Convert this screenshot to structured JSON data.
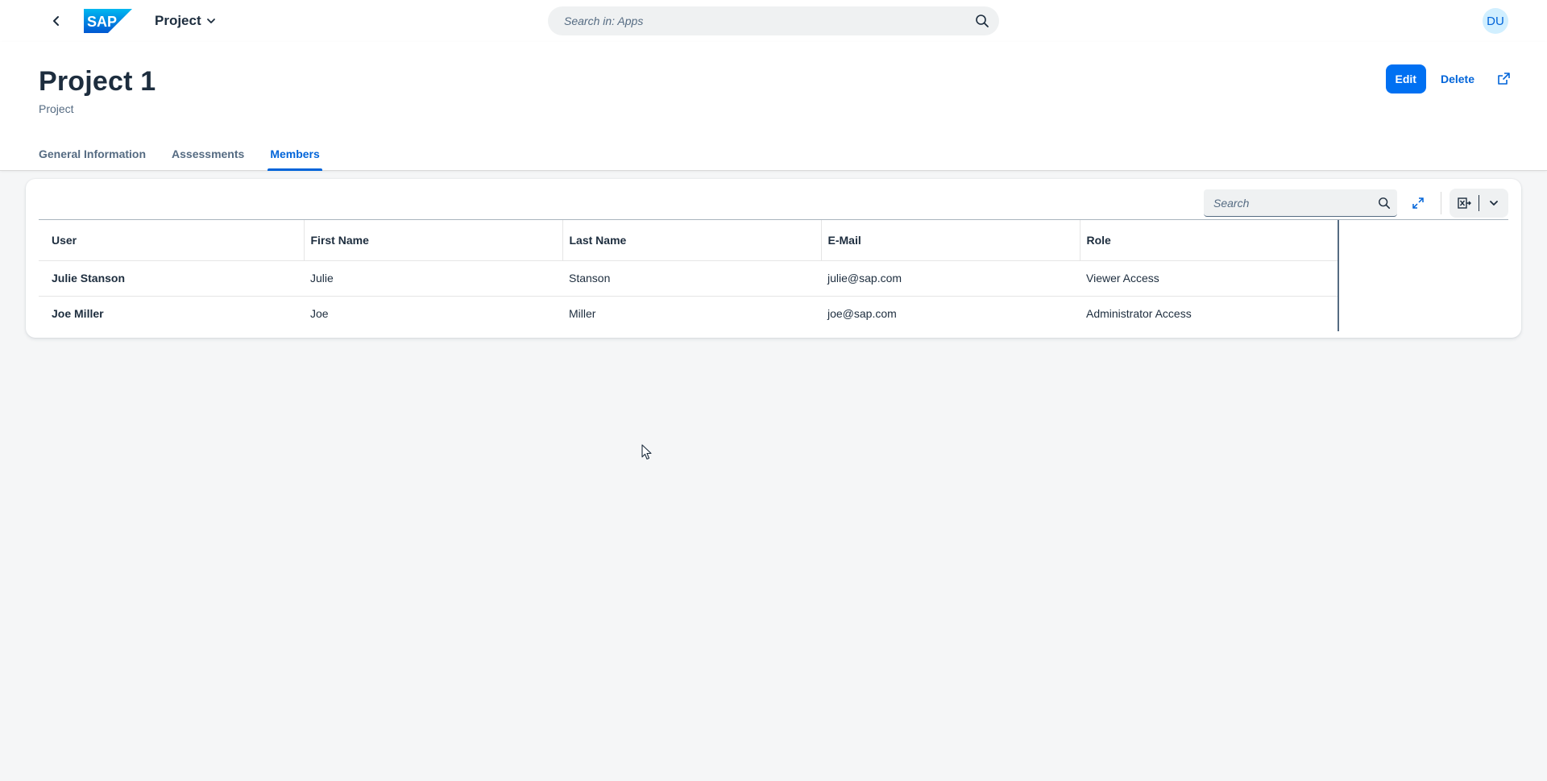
{
  "shell": {
    "app_title": "Project",
    "search_placeholder": "Search in: Apps",
    "avatar_initials": "DU",
    "logo_text": "SAP"
  },
  "header": {
    "title": "Project 1",
    "subtitle": "Project",
    "actions": {
      "edit": "Edit",
      "delete": "Delete"
    }
  },
  "tabs": [
    {
      "label": "General Information",
      "active": false
    },
    {
      "label": "Assessments",
      "active": false
    },
    {
      "label": "Members",
      "active": true
    }
  ],
  "table": {
    "search_placeholder": "Search",
    "columns": [
      "User",
      "First Name",
      "Last Name",
      "E-Mail",
      "Role"
    ],
    "rows": [
      {
        "user": "Julie Stanson",
        "first_name": "Julie",
        "last_name": "Stanson",
        "email": "julie@sap.com",
        "role": "Viewer Access"
      },
      {
        "user": "Joe Miller",
        "first_name": "Joe",
        "last_name": "Miller",
        "email": "joe@sap.com",
        "role": "Administrator Access"
      }
    ]
  },
  "colors": {
    "brand": "#0070f2",
    "link": "#0064d9",
    "text": "#1d2d3e",
    "background": "#f5f6f7"
  },
  "icons": [
    "back-icon",
    "chevron-down-icon",
    "search-icon",
    "share-icon",
    "fullscreen-icon",
    "excel-export-icon"
  ]
}
